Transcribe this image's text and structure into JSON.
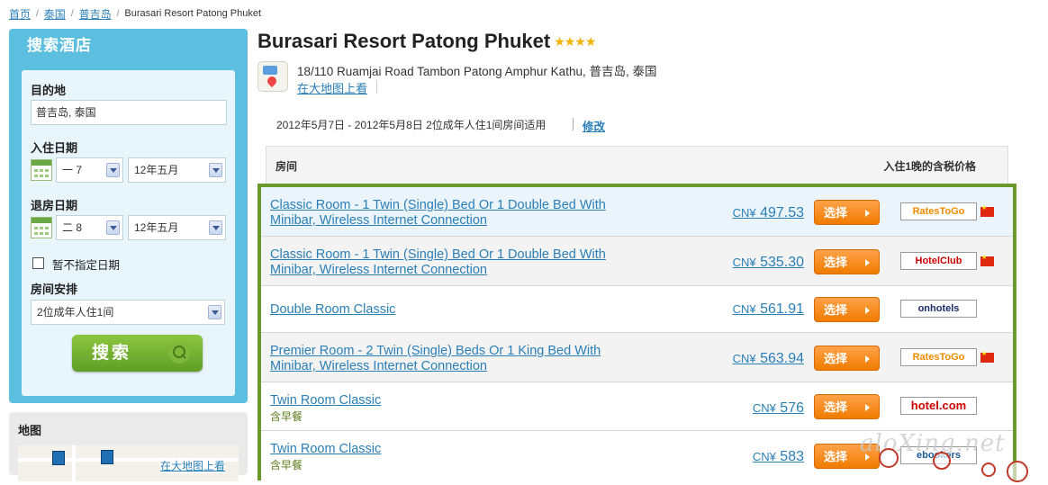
{
  "breadcrumb": {
    "items": [
      "首页",
      "泰国",
      "普吉岛"
    ],
    "current": "Burasari Resort Patong Phuket"
  },
  "sidebar": {
    "title": "搜索酒店",
    "destination_label": "目的地",
    "destination_value": "普吉岛, 泰国",
    "checkin_label": "入住日期",
    "checkin_day": "一 7",
    "checkin_month": "12年五月",
    "checkout_label": "退房日期",
    "checkout_day": "二 8",
    "checkout_month": "12年五月",
    "no_date_label": "暂不指定日期",
    "rooms_label": "房间安排",
    "rooms_value": "2位成年人住1间",
    "search_button": "搜索"
  },
  "map_box": {
    "title": "地图",
    "link": "在大地图上看"
  },
  "hotel": {
    "name": "Burasari Resort Patong Phuket",
    "stars": "★★★★",
    "address": "18/110 Ruamjai Road Tambon Patong Amphur Kathu, 普吉岛, 泰国",
    "map_link": "在大地图上看"
  },
  "stay": {
    "summary": "2012年5月7日 - 2012年5月8日  2位成年人住1间房间适用",
    "modify": "修改"
  },
  "table": {
    "col_room": "房间",
    "col_price": "入住1晚的含税价格",
    "rows": [
      {
        "name": "Classic Room - 1 Twin (Single) Bed Or 1 Double Bed With Minibar, Wireless Internet Connection",
        "breakfast": "",
        "currency": "CN¥",
        "price": "497.53",
        "button": "选择",
        "provider": "RatesToGo",
        "flag": true
      },
      {
        "name": "Classic Room - 1 Twin (Single) Bed Or 1 Double Bed With Minibar, Wireless Internet Connection",
        "breakfast": "",
        "currency": "CN¥",
        "price": "535.30",
        "button": "选择",
        "provider": "HotelClub",
        "flag": true
      },
      {
        "name": "Double Room Classic",
        "breakfast": "",
        "currency": "CN¥",
        "price": "561.91",
        "button": "选择",
        "provider": "onhotels",
        "flag": false
      },
      {
        "name": "Premier Room - 2 Twin (Single) Beds Or 1 King Bed With Minibar, Wireless Internet Connection",
        "breakfast": "",
        "currency": "CN¥",
        "price": "563.94",
        "button": "选择",
        "provider": "RatesToGo",
        "flag": true
      },
      {
        "name": "Twin Room Classic",
        "breakfast": "含早餐",
        "currency": "CN¥",
        "price": "576",
        "button": "选择",
        "provider": "hotel.com",
        "flag": false
      },
      {
        "name": "Twin Room Classic",
        "breakfast": "含早餐",
        "currency": "CN¥",
        "price": "583",
        "button": "选择",
        "provider": "ebookers",
        "flag": false
      }
    ]
  },
  "watermark": "aloXing.net",
  "colors": {
    "accent": "#5dbfe0",
    "border_green": "#6b9a2a",
    "button_orange": "#f08a1a",
    "link": "#2a7fb8"
  }
}
